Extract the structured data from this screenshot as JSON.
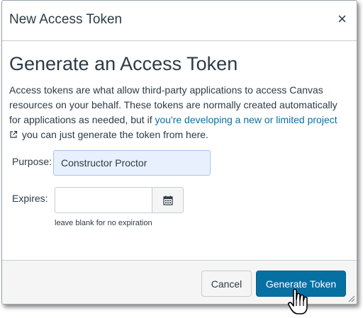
{
  "dialog": {
    "title": "New Access Token",
    "close_icon": "close-icon",
    "close_glyph": "×"
  },
  "body": {
    "heading": "Generate an Access Token",
    "description_before_link": "Access tokens are what allow third-party applications to access Canvas resources on your behalf. These tokens are normally created automatically for applications as needed, but if ",
    "link_text": "you're developing a new or limited project",
    "link_icon": "external-link-icon",
    "description_after_link": " you can just generate the token from here."
  },
  "form": {
    "purpose_label": "Purpose:",
    "purpose_value": "Constructor Proctor",
    "expires_label": "Expires:",
    "expires_value": "",
    "calendar_icon": "calendar-icon",
    "expires_hint": "leave blank for no expiration"
  },
  "footer": {
    "cancel_label": "Cancel",
    "generate_label": "Generate Token"
  },
  "colors": {
    "link": "#0770a3",
    "primary_button": "#0770a3",
    "input_autofill": "#e8f0fe",
    "footer_bg": "#f5f5f5",
    "text": "#2d3b45"
  }
}
